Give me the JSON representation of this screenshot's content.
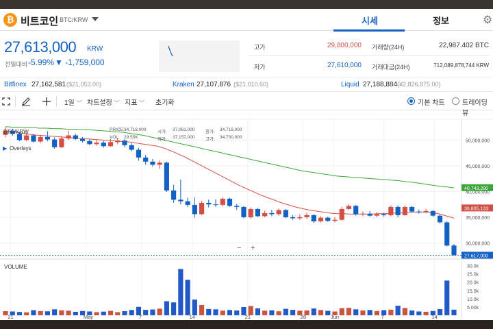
{
  "header": {
    "coin_icon": "bitcoin-icon",
    "coin_name": "비트코인",
    "pair": "BTC/KRW",
    "tabs": [
      {
        "label": "시세",
        "active": true
      },
      {
        "label": "정보",
        "active": false
      }
    ],
    "settings_icon": "gear-icon"
  },
  "price": {
    "current": "27,613,000",
    "unit": "KRW",
    "change_label": "전일대비",
    "change_pct": "-5.99%",
    "change_abs": "▼ -1,759,000"
  },
  "stats": [
    {
      "label": "고가",
      "value": "29,800,000",
      "color": "#d24f45"
    },
    {
      "label": "저가",
      "value": "27,610,000",
      "color": "#1261c4"
    },
    {
      "label": "거래량(24H)",
      "value": "22,987.402 BTC",
      "color": "#333333"
    },
    {
      "label": "거래대금(24H)",
      "value": "712,089,878,744 KRW",
      "color": "#333333"
    }
  ],
  "exchanges": [
    {
      "name": "Bitfinex",
      "price": "27,162,581",
      "sub": "($21,053.00)"
    },
    {
      "name": "Kraken",
      "price": "27,107,876",
      "sub": "($21,010.60)"
    },
    {
      "name": "Liquid",
      "price": "27,188,884",
      "sub": "(¥2,826,875.00)"
    }
  ],
  "toolbar": {
    "icons": [
      "fullscreen-icon",
      "pencil-icon",
      "crosshair-icon"
    ],
    "interval": "1일",
    "chart_settings": "차트설정",
    "indicators": "지표",
    "reset": "초기화",
    "view_basic": "기본 차트",
    "view_tradingview": "트레이딩뷰"
  },
  "chart_overlay": {
    "symbol": "BTC/KRW",
    "ohlc_labels": [
      {
        "label": "PRICE:",
        "value": "34,718,000"
      },
      {
        "label": "시가:",
        "value": "37,061,000"
      },
      {
        "label": "종가:",
        "value": "34,718,000"
      },
      {
        "label": "VOL:",
        "value": "29.55K"
      },
      {
        "label": "저가:",
        "value": "37,157,000"
      },
      {
        "label": "고가:",
        "value": "34,700,000"
      }
    ],
    "overlays_label": "Overlays",
    "volume_label": "VOLUME",
    "zoom_out": "−",
    "zoom_in": "+"
  },
  "chart_data": {
    "type": "candlestick",
    "price_ticks": [
      "50,000,000",
      "45,000,000",
      "40,000,000",
      "35,000,000",
      "30,000,000"
    ],
    "volume_ticks": [
      "30.0k",
      "25.0k",
      "20.0k",
      "15.0k",
      "10.0k",
      "5.00k"
    ],
    "x_ticks": [
      "21",
      "May",
      "7",
      "14",
      "21",
      "28",
      "Jun",
      "7",
      "14"
    ],
    "price_badges": [
      {
        "value": "40,743,280",
        "color": "#3aa63a"
      },
      {
        "value": "36,805,133",
        "color": "#d24f45"
      },
      {
        "value": "27,617,000",
        "color": "#1261c4"
      }
    ],
    "candles": [
      {
        "o": 51.0,
        "c": 51.8,
        "h": 52.5,
        "l": 50.5,
        "v": 2.5
      },
      {
        "o": 51.8,
        "c": 51.2,
        "h": 52.2,
        "l": 50.8,
        "v": 2.3
      },
      {
        "o": 51.2,
        "c": 50.0,
        "h": 51.6,
        "l": 49.8,
        "v": 2.0
      },
      {
        "o": 50.0,
        "c": 50.9,
        "h": 51.4,
        "l": 49.8,
        "v": 1.8
      },
      {
        "o": 50.9,
        "c": 49.7,
        "h": 51.2,
        "l": 49.5,
        "v": 3.1
      },
      {
        "o": 49.7,
        "c": 50.6,
        "h": 51.0,
        "l": 49.4,
        "v": 2.6
      },
      {
        "o": 50.6,
        "c": 50.1,
        "h": 51.7,
        "l": 49.8,
        "v": 2.4
      },
      {
        "o": 50.1,
        "c": 48.6,
        "h": 50.5,
        "l": 48.3,
        "v": 3.6
      },
      {
        "o": 48.6,
        "c": 50.3,
        "h": 50.8,
        "l": 48.4,
        "v": 3.0
      },
      {
        "o": 50.3,
        "c": 50.9,
        "h": 51.8,
        "l": 50.0,
        "v": 2.8
      },
      {
        "o": 50.9,
        "c": 50.2,
        "h": 51.2,
        "l": 50.0,
        "v": 2.1
      },
      {
        "o": 50.2,
        "c": 49.8,
        "h": 50.6,
        "l": 49.5,
        "v": 2.6
      },
      {
        "o": 49.8,
        "c": 49.2,
        "h": 50.1,
        "l": 49.0,
        "v": 2.3
      },
      {
        "o": 49.2,
        "c": 49.5,
        "h": 50.0,
        "l": 48.9,
        "v": 1.9
      },
      {
        "o": 49.5,
        "c": 48.8,
        "h": 49.8,
        "l": 48.5,
        "v": 2.2
      },
      {
        "o": 48.8,
        "c": 49.6,
        "h": 50.2,
        "l": 48.7,
        "v": 2.7
      },
      {
        "o": 49.6,
        "c": 49.9,
        "h": 50.4,
        "l": 49.2,
        "v": 1.9
      },
      {
        "o": 49.9,
        "c": 49.0,
        "h": 50.1,
        "l": 48.6,
        "v": 2.5
      },
      {
        "o": 49.0,
        "c": 48.1,
        "h": 49.4,
        "l": 47.8,
        "v": 3.2
      },
      {
        "o": 48.1,
        "c": 46.6,
        "h": 48.5,
        "l": 46.0,
        "v": 5.1
      },
      {
        "o": 46.6,
        "c": 45.8,
        "h": 47.1,
        "l": 45.2,
        "v": 3.3
      },
      {
        "o": 45.8,
        "c": 45.2,
        "h": 46.3,
        "l": 44.8,
        "v": 3.5
      },
      {
        "o": 45.2,
        "c": 45.6,
        "h": 46.0,
        "l": 44.4,
        "v": 4.0
      },
      {
        "o": 45.6,
        "c": 40.2,
        "h": 45.8,
        "l": 39.9,
        "v": 8.5
      },
      {
        "o": 40.2,
        "c": 38.4,
        "h": 41.3,
        "l": 37.8,
        "v": 7.8
      },
      {
        "o": 38.4,
        "c": 38.1,
        "h": 42.3,
        "l": 37.5,
        "v": 28.0
      },
      {
        "o": 38.1,
        "c": 37.4,
        "h": 38.8,
        "l": 37.0,
        "v": 21.5
      },
      {
        "o": 37.4,
        "c": 35.6,
        "h": 38.9,
        "l": 34.9,
        "v": 9.5
      },
      {
        "o": 35.6,
        "c": 37.8,
        "h": 38.2,
        "l": 35.4,
        "v": 6.2
      },
      {
        "o": 37.8,
        "c": 37.5,
        "h": 38.4,
        "l": 36.9,
        "v": 3.8
      },
      {
        "o": 37.5,
        "c": 37.4,
        "h": 38.5,
        "l": 37.0,
        "v": 3.6
      },
      {
        "o": 37.4,
        "c": 38.6,
        "h": 38.9,
        "l": 37.1,
        "v": 2.8
      },
      {
        "o": 38.6,
        "c": 37.2,
        "h": 38.8,
        "l": 37.0,
        "v": 3.2
      },
      {
        "o": 37.2,
        "c": 37.0,
        "h": 37.6,
        "l": 36.4,
        "v": 2.9
      },
      {
        "o": 37.0,
        "c": 35.0,
        "h": 37.2,
        "l": 34.8,
        "v": 5.0
      },
      {
        "o": 35.0,
        "c": 36.6,
        "h": 36.9,
        "l": 34.7,
        "v": 5.6
      },
      {
        "o": 36.6,
        "c": 35.2,
        "h": 36.8,
        "l": 35.0,
        "v": 4.2
      },
      {
        "o": 35.2,
        "c": 35.8,
        "h": 36.3,
        "l": 35.0,
        "v": 2.8
      },
      {
        "o": 35.8,
        "c": 35.6,
        "h": 36.4,
        "l": 35.2,
        "v": 3.0
      },
      {
        "o": 35.6,
        "c": 36.4,
        "h": 36.7,
        "l": 35.3,
        "v": 2.4
      },
      {
        "o": 36.4,
        "c": 35.0,
        "h": 36.6,
        "l": 34.8,
        "v": 3.9
      },
      {
        "o": 35.0,
        "c": 34.8,
        "h": 35.4,
        "l": 34.5,
        "v": 3.3
      },
      {
        "o": 34.8,
        "c": 35.0,
        "h": 35.6,
        "l": 34.5,
        "v": 2.8
      },
      {
        "o": 35.0,
        "c": 35.4,
        "h": 35.9,
        "l": 34.7,
        "v": 2.9
      },
      {
        "o": 35.4,
        "c": 34.2,
        "h": 35.6,
        "l": 33.9,
        "v": 4.1
      },
      {
        "o": 34.2,
        "c": 34.9,
        "h": 35.2,
        "l": 34.0,
        "v": 3.2
      },
      {
        "o": 34.9,
        "c": 34.3,
        "h": 35.1,
        "l": 34.1,
        "v": 2.7
      },
      {
        "o": 34.3,
        "c": 34.5,
        "h": 35.0,
        "l": 34.0,
        "v": 2.3
      },
      {
        "o": 34.5,
        "c": 36.6,
        "h": 37.0,
        "l": 34.3,
        "v": 4.3
      },
      {
        "o": 36.6,
        "c": 37.2,
        "h": 37.5,
        "l": 36.4,
        "v": 4.5
      },
      {
        "o": 37.2,
        "c": 35.6,
        "h": 37.4,
        "l": 35.3,
        "v": 3.6
      },
      {
        "o": 35.6,
        "c": 35.7,
        "h": 36.1,
        "l": 35.2,
        "v": 2.9
      },
      {
        "o": 35.7,
        "c": 35.3,
        "h": 36.2,
        "l": 35.1,
        "v": 3.2
      },
      {
        "o": 35.3,
        "c": 35.6,
        "h": 36.0,
        "l": 35.0,
        "v": 2.6
      },
      {
        "o": 35.6,
        "c": 35.4,
        "h": 35.9,
        "l": 35.1,
        "v": 3.1
      },
      {
        "o": 35.4,
        "c": 37.0,
        "h": 37.3,
        "l": 35.2,
        "v": 3.4
      },
      {
        "o": 37.0,
        "c": 35.4,
        "h": 37.3,
        "l": 35.0,
        "v": 5.8
      },
      {
        "o": 35.4,
        "c": 37.0,
        "h": 37.3,
        "l": 35.3,
        "v": 4.4
      },
      {
        "o": 37.0,
        "c": 36.1,
        "h": 37.2,
        "l": 35.9,
        "v": 2.9
      },
      {
        "o": 36.1,
        "c": 36.0,
        "h": 36.5,
        "l": 35.7,
        "v": 2.3
      },
      {
        "o": 36.0,
        "c": 36.2,
        "h": 36.6,
        "l": 35.8,
        "v": 2.1
      },
      {
        "o": 36.2,
        "c": 35.3,
        "h": 36.4,
        "l": 35.1,
        "v": 2.6
      },
      {
        "o": 35.3,
        "c": 34.0,
        "h": 35.5,
        "l": 33.8,
        "v": 3.7
      },
      {
        "o": 34.0,
        "c": 29.5,
        "h": 34.2,
        "l": 29.3,
        "v": 21.0
      },
      {
        "o": 29.5,
        "c": 27.6,
        "h": 29.8,
        "l": 27.6,
        "v": 3.4
      }
    ],
    "ma_slow": [
      52.6,
      52.5,
      52.5,
      52.4,
      52.4,
      52.3,
      52.3,
      52.2,
      52.2,
      52.1,
      52.1,
      52.0,
      52.0,
      51.9,
      51.8,
      51.7,
      51.6,
      51.5,
      51.3,
      51.1,
      50.9,
      50.6,
      50.3,
      50.0,
      49.7,
      49.4,
      49.1,
      48.8,
      48.5,
      48.2,
      47.9,
      47.6,
      47.3,
      47.0,
      46.7,
      46.4,
      46.1,
      45.8,
      45.5,
      45.2,
      44.9,
      44.6,
      44.3,
      44.0,
      43.8,
      43.6,
      43.4,
      43.2,
      43.0,
      42.9,
      42.8,
      42.7,
      42.6,
      42.5,
      42.4,
      42.3,
      42.2,
      42.1,
      41.9,
      41.8,
      41.6,
      41.4,
      41.2,
      41.0,
      40.9,
      40.7
    ],
    "ma_fast": [
      51.8,
      51.6,
      51.4,
      51.2,
      51.0,
      50.9,
      50.8,
      50.7,
      50.6,
      50.5,
      50.4,
      50.3,
      50.2,
      50.1,
      50.0,
      49.9,
      49.8,
      49.7,
      49.6,
      49.4,
      49.2,
      49.0,
      48.8,
      48.4,
      47.9,
      47.3,
      46.7,
      46.0,
      45.3,
      44.6,
      43.9,
      43.2,
      42.5,
      41.8,
      41.1,
      40.5,
      39.9,
      39.3,
      38.8,
      38.3,
      37.8,
      37.4,
      37.0,
      36.7,
      36.4,
      36.2,
      36.0,
      35.8,
      35.7,
      35.7,
      35.6,
      35.6,
      35.6,
      35.6,
      35.7,
      35.7,
      35.8,
      35.8,
      35.9,
      36.0,
      36.0,
      36.0,
      35.9,
      35.6,
      35.2,
      34.8
    ]
  }
}
